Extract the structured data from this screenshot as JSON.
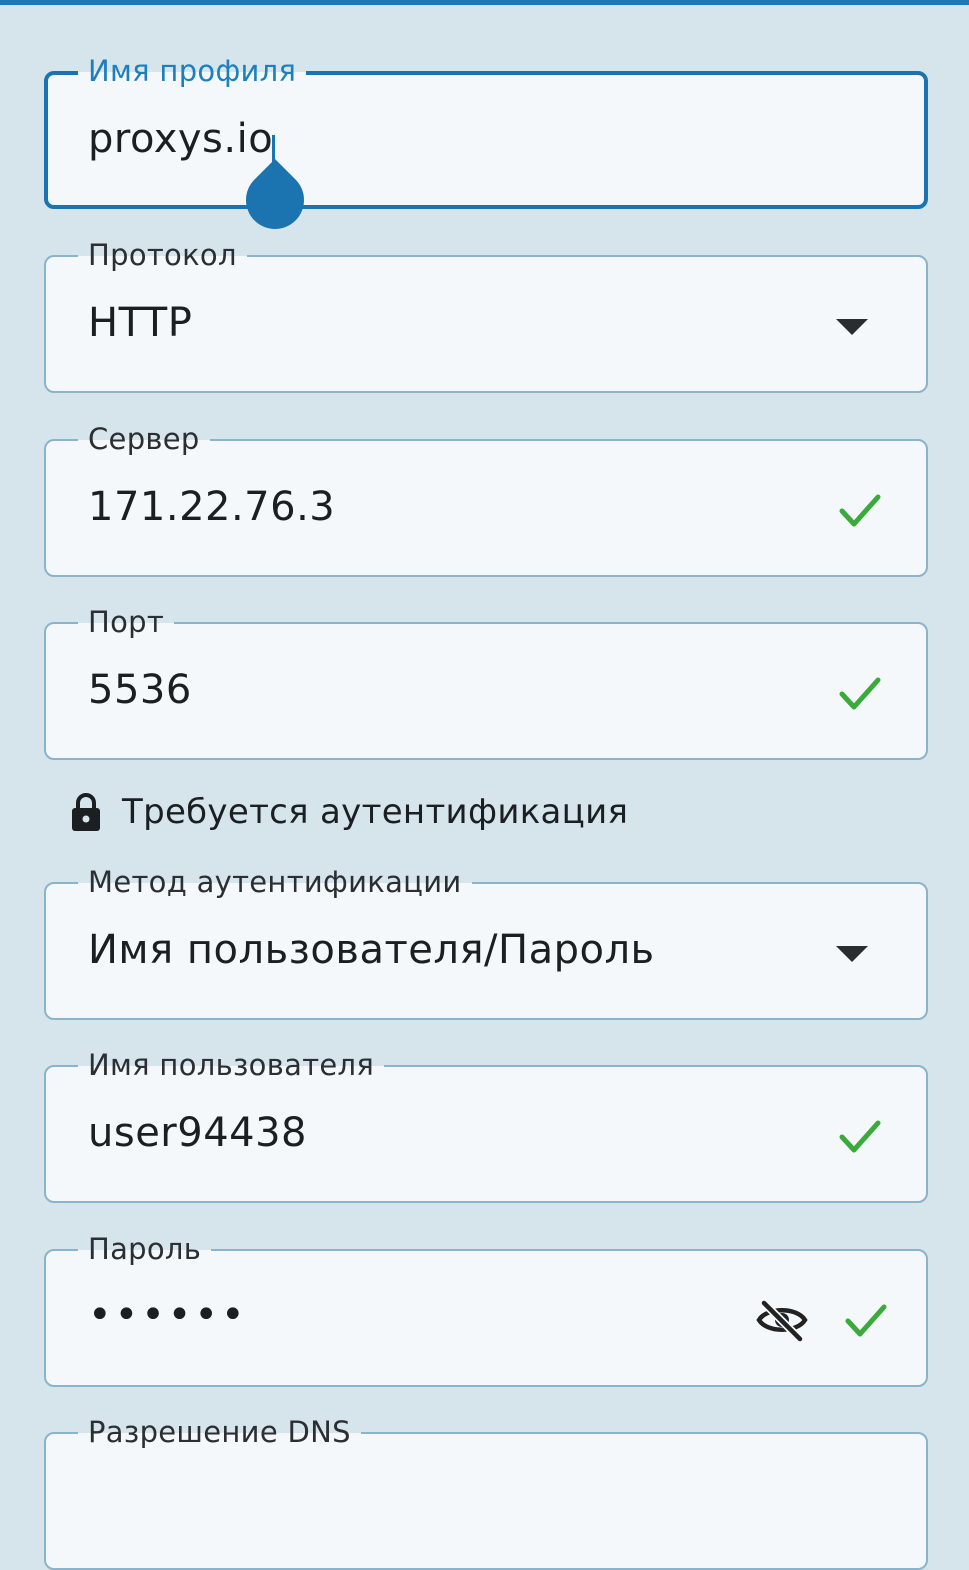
{
  "profile_name": {
    "label": "Имя профиля",
    "value": "proxys.io"
  },
  "protocol": {
    "label": "Протокол",
    "value": "HTTP",
    "icon": "dropdown-arrow-icon"
  },
  "server": {
    "label": "Сервер",
    "value": "171.22.76.3",
    "icon": "check-icon"
  },
  "port": {
    "label": "Порт",
    "value": "5536",
    "icon": "check-icon"
  },
  "auth_required": {
    "text": "Требуется аутентификация",
    "icon": "lock-icon"
  },
  "auth_method": {
    "label": "Метод аутентификации",
    "value": "Имя пользователя/Пароль",
    "icon": "dropdown-arrow-icon"
  },
  "username": {
    "label": "Имя пользователя",
    "value": "user94438",
    "icon": "check-icon"
  },
  "password": {
    "label": "Пароль",
    "value": "••••••",
    "icons": [
      "eye-off-icon",
      "check-icon"
    ]
  },
  "dns": {
    "label": "Разрешение DNS"
  },
  "colors": {
    "accent": "#1b74b0",
    "valid": "#3aaa3a",
    "background": "#d6e4ec",
    "field": "#f4f8fb"
  }
}
